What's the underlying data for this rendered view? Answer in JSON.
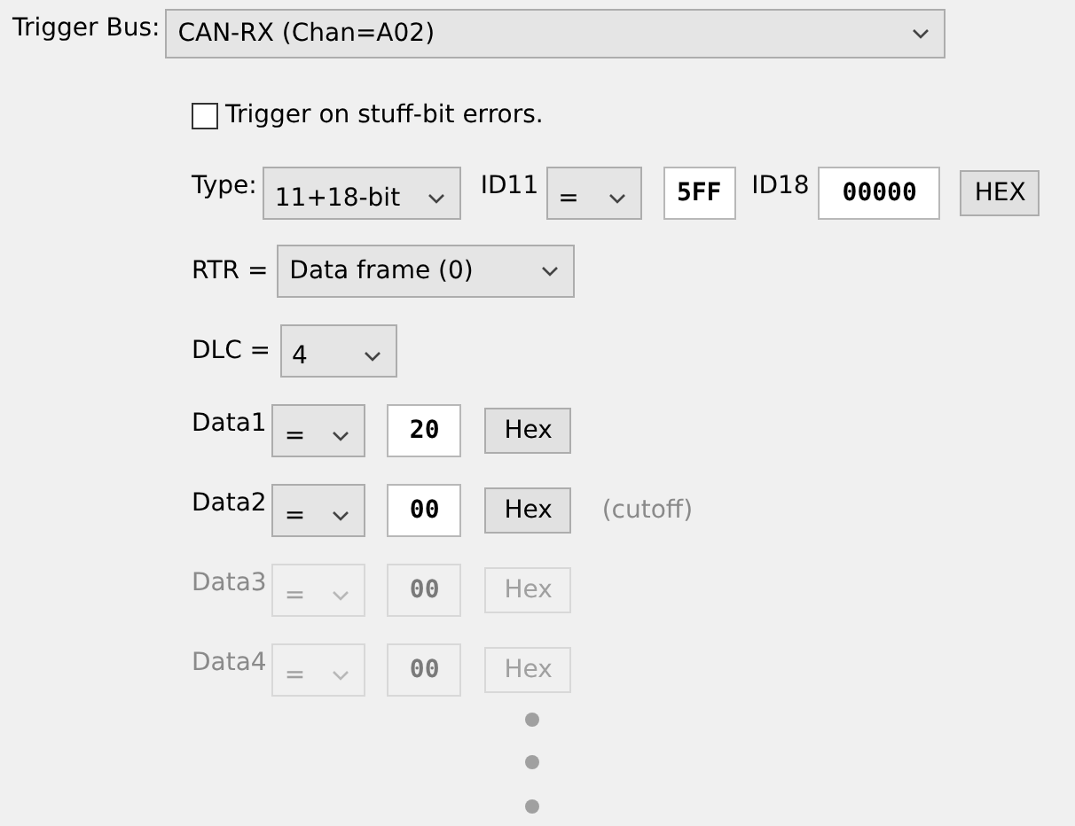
{
  "trigger_bus": {
    "label": "Trigger Bus:",
    "value": "CAN-RX (Chan=A02)"
  },
  "stuff_bit": {
    "label": "Trigger on stuff-bit errors.",
    "checked": false
  },
  "type_row": {
    "label": "Type:",
    "type_value": "11+18-bit",
    "id11_label": "ID11",
    "id11_op": "=",
    "id11_value": "5FF",
    "id18_label": "ID18",
    "id18_value": "00000",
    "format_button": "HEX"
  },
  "rtr": {
    "label": "RTR =",
    "value": "Data frame (0)"
  },
  "dlc": {
    "label": "DLC =",
    "value": "4"
  },
  "data_bytes": [
    {
      "label": "Data1",
      "op": "=",
      "value": "20",
      "format_button": "Hex",
      "disabled": false
    },
    {
      "label": "Data2",
      "op": "=",
      "value": "00",
      "format_button": "Hex",
      "disabled": false,
      "note": "(cutoff)"
    },
    {
      "label": "Data3",
      "op": "=",
      "value": "00",
      "format_button": "Hex",
      "disabled": true
    },
    {
      "label": "Data4",
      "op": "=",
      "value": "00",
      "format_button": "Hex",
      "disabled": true
    }
  ]
}
